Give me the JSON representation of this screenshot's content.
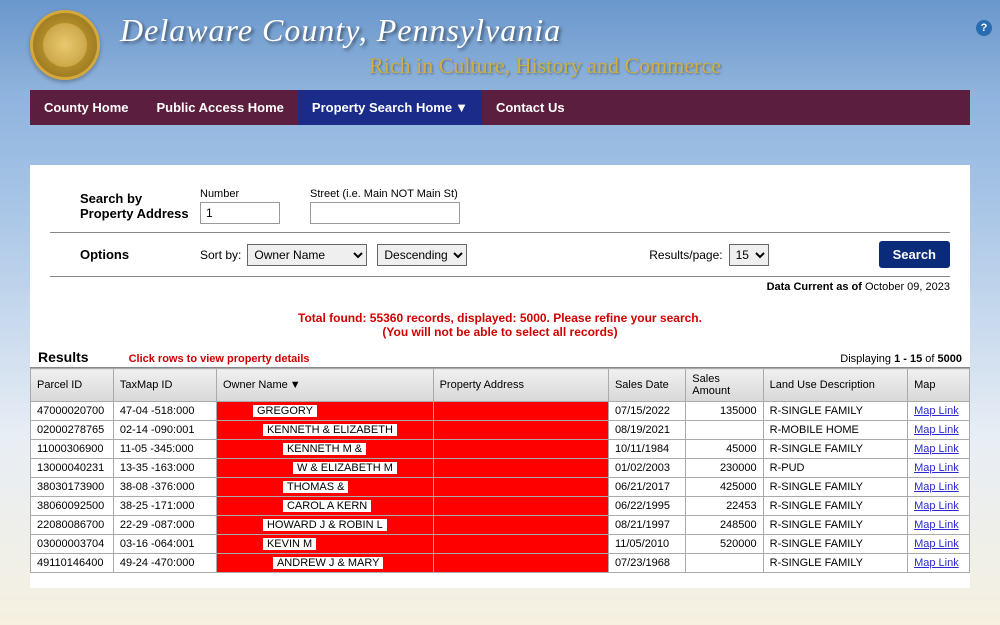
{
  "header": {
    "title": "Delaware County, Pennsylvania",
    "tagline": "Rich in Culture, History and Commerce",
    "help_text": "?"
  },
  "nav": {
    "items": [
      {
        "label": "County Home",
        "active": false,
        "dropdown": false
      },
      {
        "label": "Public Access Home",
        "active": false,
        "dropdown": false
      },
      {
        "label": "Property Search Home",
        "active": true,
        "dropdown": true
      },
      {
        "label": "Contact Us",
        "active": false,
        "dropdown": false
      }
    ]
  },
  "search": {
    "section_label_line1": "Search by",
    "section_label_line2": "Property Address",
    "number_label": "Number",
    "number_value": "1",
    "street_label": "Street (i.e. Main NOT Main St)",
    "street_value": ""
  },
  "options": {
    "section_label": "Options",
    "sort_by_label": "Sort by:",
    "sort_by_value": "Owner Name",
    "sort_dir_value": "Descending",
    "results_per_page_label": "Results/page:",
    "results_per_page_value": "15",
    "search_button": "Search"
  },
  "status": {
    "data_current_label": "Data Current as of",
    "data_current_value": "October 09, 2023",
    "warning_line1": "Total found: 55360 records, displayed: 5000. Please refine your search.",
    "warning_line2": "(You will not be able to select all records)"
  },
  "results": {
    "title": "Results",
    "hint": "Click rows to view property details",
    "displaying_prefix": "Displaying",
    "displaying_range": "1 - 15",
    "displaying_of": "of",
    "displaying_total": "5000",
    "columns": {
      "parcel": "Parcel ID",
      "taxmap": "TaxMap ID",
      "owner": "Owner Name",
      "address": "Property Address",
      "sales_date": "Sales Date",
      "sales_amount": "Sales Amount",
      "land_use": "Land Use Description",
      "map": "Map"
    },
    "map_link_label": "Map Link",
    "rows": [
      {
        "parcel": "47000020700",
        "taxmap": "47-04 -518:000",
        "owner": "GREGORY",
        "owner_indent": 30,
        "sales_date": "07/15/2022",
        "sales_amount": "135000",
        "land_use": "R-SINGLE FAMILY"
      },
      {
        "parcel": "02000278765",
        "taxmap": "02-14 -090:001",
        "owner": "KENNETH & ELIZABETH",
        "owner_indent": 40,
        "sales_date": "08/19/2021",
        "sales_amount": "",
        "land_use": "R-MOBILE HOME"
      },
      {
        "parcel": "11000306900",
        "taxmap": "11-05 -345:000",
        "owner": "KENNETH M &",
        "owner_indent": 60,
        "sales_date": "10/11/1984",
        "sales_amount": "45000",
        "land_use": "R-SINGLE FAMILY"
      },
      {
        "parcel": "13000040231",
        "taxmap": "13-35 -163:000",
        "owner": "W & ELIZABETH M",
        "owner_indent": 70,
        "sales_date": "01/02/2003",
        "sales_amount": "230000",
        "land_use": "R-PUD"
      },
      {
        "parcel": "38030173900",
        "taxmap": "38-08 -376:000",
        "owner": "THOMAS &",
        "owner_indent": 60,
        "sales_date": "06/21/2017",
        "sales_amount": "425000",
        "land_use": "R-SINGLE FAMILY"
      },
      {
        "parcel": "38060092500",
        "taxmap": "38-25 -171:000",
        "owner": "CAROL A KERN",
        "owner_indent": 60,
        "sales_date": "06/22/1995",
        "sales_amount": "22453",
        "land_use": "R-SINGLE FAMILY"
      },
      {
        "parcel": "22080086700",
        "taxmap": "22-29 -087:000",
        "owner": "HOWARD J & ROBIN L",
        "owner_indent": 40,
        "sales_date": "08/21/1997",
        "sales_amount": "248500",
        "land_use": "R-SINGLE FAMILY"
      },
      {
        "parcel": "03000003704",
        "taxmap": "03-16 -064:001",
        "owner": "KEVIN M",
        "owner_indent": 40,
        "sales_date": "11/05/2010",
        "sales_amount": "520000",
        "land_use": "R-SINGLE FAMILY"
      },
      {
        "parcel": "49110146400",
        "taxmap": "49-24 -470:000",
        "owner": "ANDREW J & MARY",
        "owner_indent": 50,
        "sales_date": "07/23/1968",
        "sales_amount": "",
        "land_use": "R-SINGLE FAMILY"
      }
    ]
  }
}
